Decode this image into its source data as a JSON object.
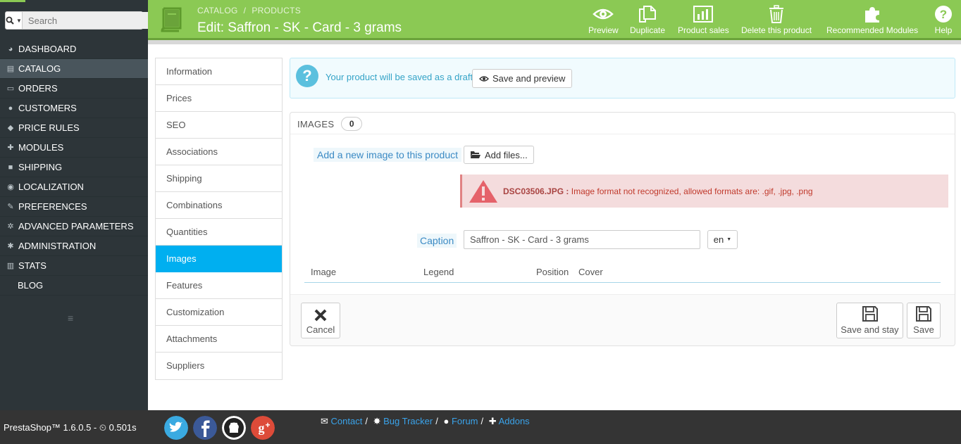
{
  "search": {
    "placeholder": "Search"
  },
  "nav": [
    {
      "label": "DASHBOARD",
      "icon": "dashboard-icon",
      "glyph": "◕"
    },
    {
      "label": "CATALOG",
      "icon": "book-icon",
      "glyph": "▤"
    },
    {
      "label": "ORDERS",
      "icon": "credit-card-icon",
      "glyph": "▭"
    },
    {
      "label": "CUSTOMERS",
      "icon": "users-icon",
      "glyph": "●"
    },
    {
      "label": "PRICE RULES",
      "icon": "tag-icon",
      "glyph": "◆"
    },
    {
      "label": "MODULES",
      "icon": "puzzle-icon",
      "glyph": "✚"
    },
    {
      "label": "SHIPPING",
      "icon": "truck-icon",
      "glyph": "■"
    },
    {
      "label": "LOCALIZATION",
      "icon": "globe-icon",
      "glyph": "◉"
    },
    {
      "label": "PREFERENCES",
      "icon": "wrench-icon",
      "glyph": "✎"
    },
    {
      "label": "ADVANCED PARAMETERS",
      "icon": "cogs-icon",
      "glyph": "✲"
    },
    {
      "label": "ADMINISTRATION",
      "icon": "gear-icon",
      "glyph": "✱"
    },
    {
      "label": "STATS",
      "icon": "bar-chart-icon",
      "glyph": "▥"
    },
    {
      "label": "BLOG",
      "icon": "",
      "glyph": ""
    }
  ],
  "header": {
    "breadcrumb": [
      "CATALOG",
      "PRODUCTS"
    ],
    "title": "Edit: Saffron - SK - Card - 3 grams",
    "toolbar": {
      "preview": "Preview",
      "duplicate": "Duplicate",
      "sales": "Product sales",
      "delete": "Delete this product",
      "modules": "Recommended Modules",
      "help": "Help"
    }
  },
  "tabs": [
    "Information",
    "Prices",
    "SEO",
    "Associations",
    "Shipping",
    "Combinations",
    "Quantities",
    "Images",
    "Features",
    "Customization",
    "Attachments",
    "Suppliers"
  ],
  "active_tab": "Images",
  "info": {
    "message": "Your product will be saved as a draft.",
    "button": "Save and preview"
  },
  "images_panel": {
    "title": "IMAGES",
    "count": "0",
    "add_label": "Add a new image to this product",
    "add_button": "Add files...",
    "error_file": "DSC03506.JPG :",
    "error_text": "Image format not recognized, allowed formats are: .gif, .jpg, .png",
    "caption_label": "Caption",
    "caption_value": "Saffron - SK - Card - 3 grams",
    "lang": "en",
    "columns": [
      "Image",
      "Legend",
      "Position",
      "Cover"
    ],
    "cancel": "Cancel",
    "save_stay": "Save and stay",
    "save": "Save"
  },
  "footer": {
    "version": "PrestaShop™ 1.6.0.5 - ",
    "time": "0.501s",
    "links": [
      "Contact",
      "Bug Tracker",
      "Forum",
      "Addons"
    ]
  },
  "colors": {
    "header_green": "#8bc954",
    "sidebar": "#2d3539",
    "active_tab": "#00aff0",
    "error_bg": "#f4dcdd"
  }
}
